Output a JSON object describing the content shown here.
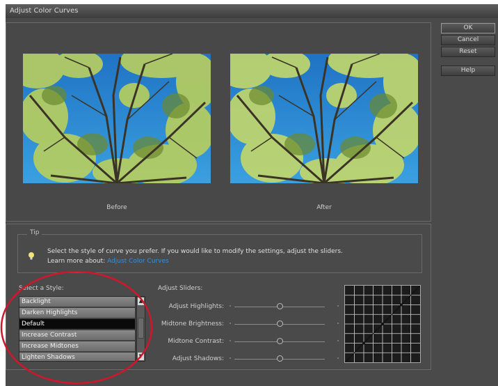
{
  "window": {
    "title": "Adjust Color Curves"
  },
  "buttons": {
    "ok": "OK",
    "cancel": "Cancel",
    "reset": "Reset",
    "help": "Help"
  },
  "preview": {
    "before_label": "Before",
    "after_label": "After"
  },
  "tip": {
    "legend": "Tip",
    "line1": "Select the style of curve you prefer. If you would like to modify the settings, adjust the sliders.",
    "learn_prefix": "Learn more about:",
    "learn_link": "Adjust Color Curves"
  },
  "styles": {
    "label": "Select a Style:",
    "items": [
      "Backlight",
      "Darken Highlights",
      "Default",
      "Increase Contrast",
      "Increase Midtones",
      "Lighten Shadows"
    ],
    "selected": "Default"
  },
  "sliders": {
    "label": "Adjust Sliders:",
    "items": [
      {
        "name": "Adjust Highlights:",
        "value": 0.5
      },
      {
        "name": "Midtone Brightness:",
        "value": 0.5
      },
      {
        "name": "Midtone Contrast:",
        "value": 0.5
      },
      {
        "name": "Adjust Shadows:",
        "value": 0.5
      }
    ]
  },
  "colors": {
    "dialog_bg": "#4a4a4a",
    "link": "#3a8fd8",
    "annotation_circle": "#d0162a",
    "sky": "#2f8fd8",
    "foliage": "#c4d86a"
  },
  "icons": {
    "tip": "lightbulb-icon",
    "scroll_up": "arrow-up-icon",
    "scroll_down": "arrow-down-icon"
  }
}
